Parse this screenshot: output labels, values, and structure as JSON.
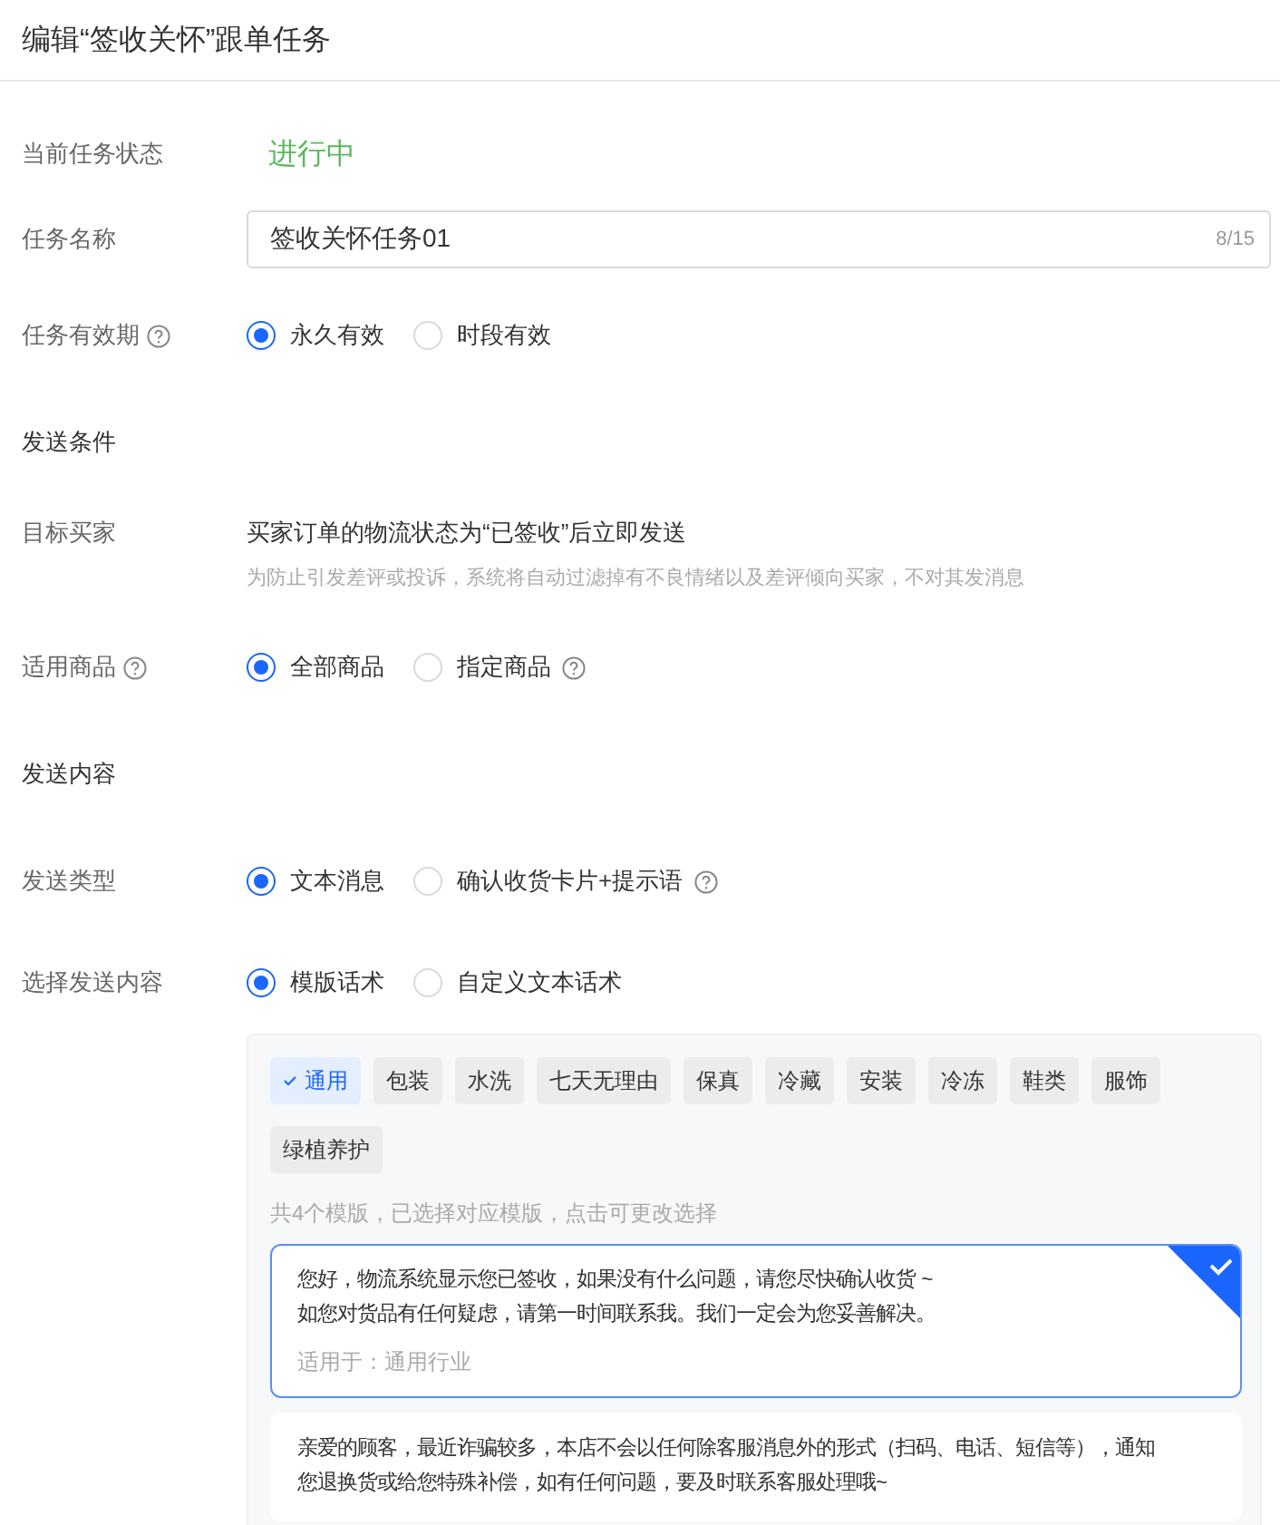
{
  "title": "编辑“签收关怀”跟单任务",
  "fields": [
    {
      "kind": "status",
      "label": "当前任务状态",
      "value": "进行中"
    },
    {
      "kind": "input",
      "label": "任务名称",
      "value": "签收关怀任务01",
      "counter": "8/15"
    },
    {
      "kind": "radio",
      "label": "任务有效期",
      "help": true,
      "options": [
        {
          "label": "永久有效",
          "selected": true,
          "help": false
        },
        {
          "label": "时段有效",
          "selected": false,
          "help": false
        }
      ]
    },
    {
      "kind": "section",
      "label": "发送条件"
    },
    {
      "kind": "text",
      "label": "目标买家",
      "value": "买家订单的物流状态为“已签收”后立即发送",
      "note": "为防止引发差评或投诉，系统将自动过滤掉有不良情绪以及差评倾向买家，不对其发消息"
    },
    {
      "kind": "radio",
      "label": "适用商品",
      "help": true,
      "options": [
        {
          "label": "全部商品",
          "selected": true,
          "help": false
        },
        {
          "label": "指定商品",
          "selected": false,
          "help": true
        }
      ]
    },
    {
      "kind": "section",
      "label": "发送内容"
    },
    {
      "kind": "radio",
      "label": "发送类型",
      "help": false,
      "options": [
        {
          "label": "文本消息",
          "selected": true,
          "help": false
        },
        {
          "label": "确认收货卡片+提示语",
          "selected": false,
          "help": true
        }
      ]
    },
    {
      "kind": "radio",
      "label": "选择发送内容",
      "help": false,
      "options": [
        {
          "label": "模版话术",
          "selected": true,
          "help": false
        },
        {
          "label": "自定义文本话术",
          "selected": false,
          "help": false
        }
      ]
    }
  ],
  "template_panel": {
    "tags": [
      {
        "label": "通用",
        "selected": true
      },
      {
        "label": "包装",
        "selected": false
      },
      {
        "label": "水洗",
        "selected": false
      },
      {
        "label": "七天无理由",
        "selected": false
      },
      {
        "label": "保真",
        "selected": false
      },
      {
        "label": "冷藏",
        "selected": false
      },
      {
        "label": "安装",
        "selected": false
      },
      {
        "label": "冷冻",
        "selected": false
      },
      {
        "label": "鞋类",
        "selected": false
      },
      {
        "label": "服饰",
        "selected": false
      },
      {
        "label": "绿植养护",
        "selected": false
      }
    ],
    "summary": "共4个模版，已选择对应模版，点击可更改选择",
    "templates": [
      {
        "lines": [
          "您好，物流系统显示您已签收，如果没有什么问题，请您尽快确认收货 ~",
          "如您对货品有任何疑虑，请第一时间联系我。我们一定会为您妥善解决。"
        ],
        "applies": "适用于：通用行业",
        "selected": true
      },
      {
        "lines": [
          "亲爱的顾客，最近诈骗较多，本店不会以任何除客服消息外的形式（扫码、电话、短信等），通知",
          "您退换货或给您特殊补偿，如有任何问题，要及时联系客服处理哦~"
        ],
        "selected": false
      }
    ]
  }
}
